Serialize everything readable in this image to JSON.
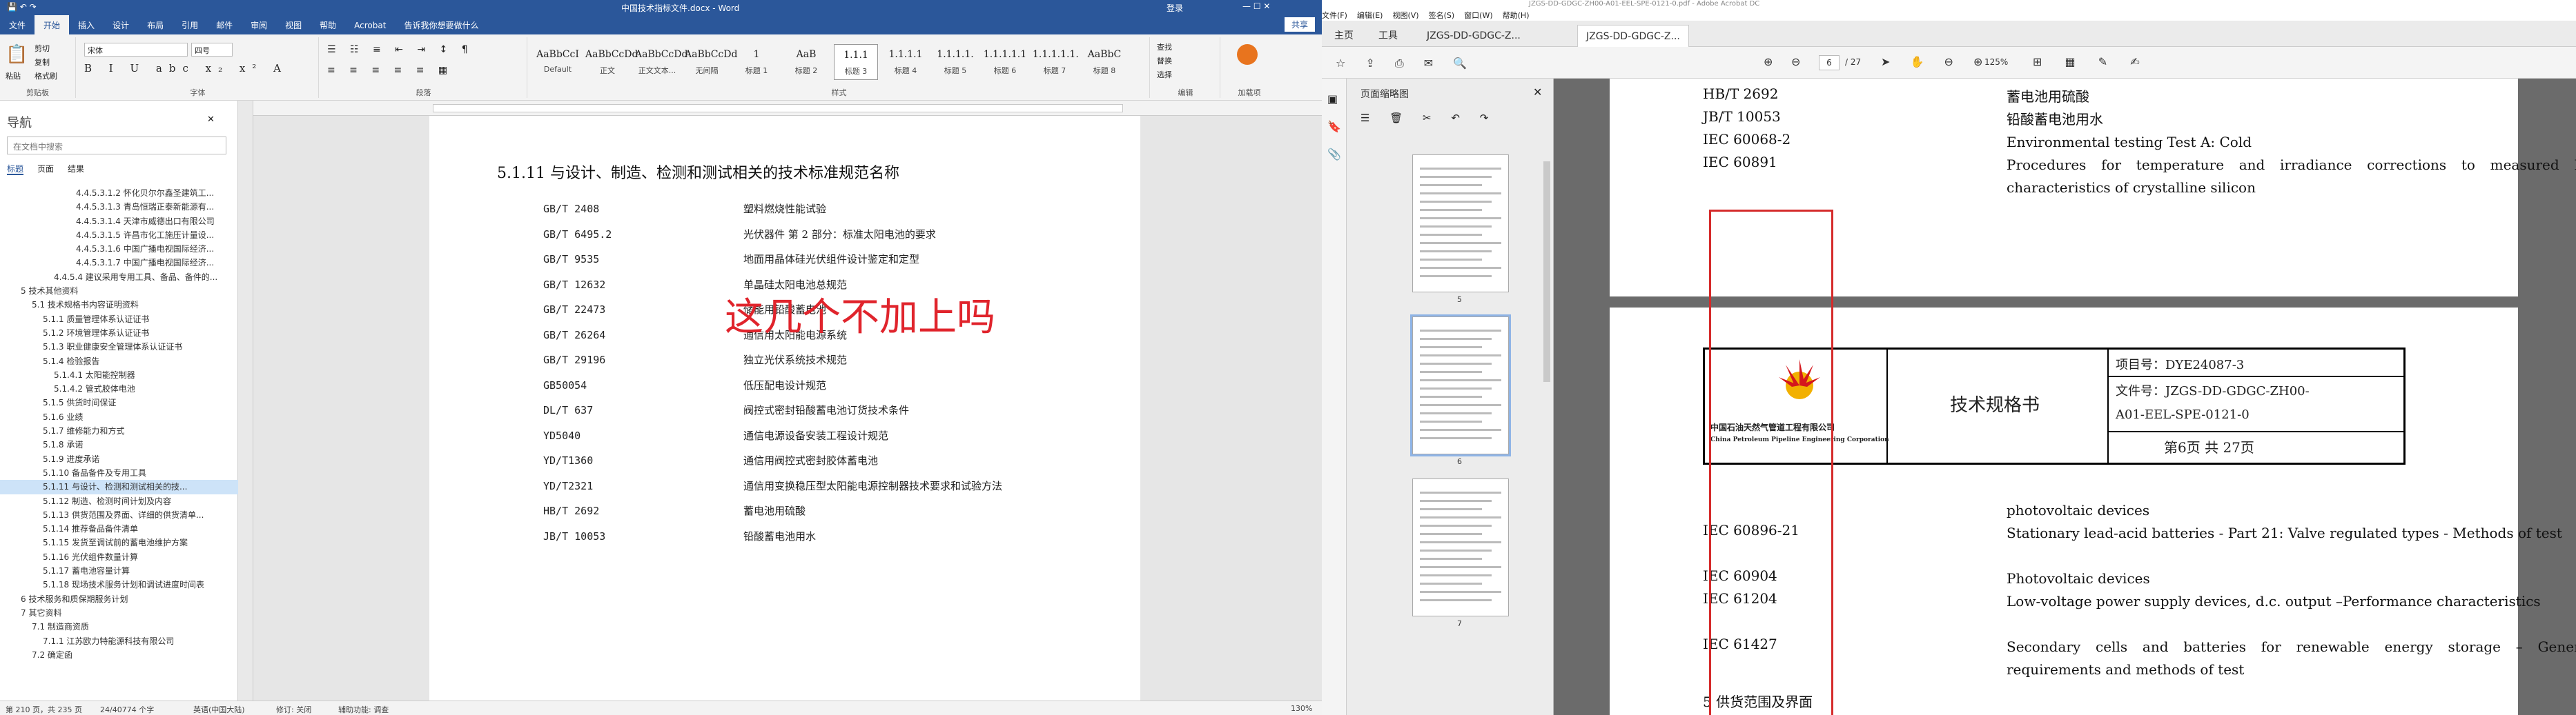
{
  "word": {
    "title": "中国技术指标文件.docx - Word",
    "title_right": "登录",
    "tabs": [
      "文件",
      "开始",
      "插入",
      "设计",
      "布局",
      "引用",
      "邮件",
      "审阅",
      "视图",
      "帮助",
      "Acrobat",
      "告诉我你想要做什么"
    ],
    "share": "共享",
    "ribbon": {
      "clipboard": {
        "paste": "粘贴",
        "cut": "剪切",
        "copy": "复制",
        "format_painter": "格式刷",
        "label": "剪贴板"
      },
      "font": {
        "name": "宋体",
        "size": "四号",
        "label": "字体"
      },
      "paragraph_label": "段落",
      "styles_label": "样式",
      "styles": [
        {
          "preview": "AaBbCcI",
          "name": "Default"
        },
        {
          "preview": "AaBbCcDd",
          "name": "正文"
        },
        {
          "preview": "AaBbCcDd",
          "name": "正文文本..."
        },
        {
          "preview": "AaBbCcDd",
          "name": "无间隔"
        },
        {
          "preview": "1",
          "name": "标题 1"
        },
        {
          "preview": "AaB",
          "name": "标题 2"
        },
        {
          "preview": "1.1.1",
          "name": "标题 3"
        },
        {
          "preview": "1.1.1.1",
          "name": "标题 4"
        },
        {
          "preview": "1.1.1.1.",
          "name": "标题 5"
        },
        {
          "preview": "1.1.1.1.1",
          "name": "标题 6"
        },
        {
          "preview": "1.1.1.1.1.",
          "name": "标题 7"
        },
        {
          "preview": "AaBbC",
          "name": "标题 8"
        }
      ],
      "editing": {
        "find": "查找",
        "replace": "替换",
        "select": "选择",
        "label": "编辑"
      },
      "acrobat": {
        "label": "加载项"
      }
    },
    "nav": {
      "title": "导航",
      "search_placeholder": "在文档中搜索",
      "tabs": [
        "标题",
        "页面",
        "结果"
      ],
      "items": [
        "4.4.5.3.1.2 怀化贝尔尔鑫圣建筑工...",
        "4.4.5.3.1.3 青岛恒瑞正泰新能源有...",
        "4.4.5.3.1.4 天津市威德出口有限公司",
        "4.4.5.3.1.5 许昌市化工施压计量设...",
        "4.4.5.3.1.6 中国广播电视国际经济...",
        "4.4.5.3.1.7 中国广播电视国际经济...",
        "4.4.5.4 建议采用专用工具、备品、备件的...",
        "5 技术其他资料",
        "5.1 技术规格书内容证明资料",
        "5.1.1 质量管理体系认证证书",
        "5.1.2 环境管理体系认证证书",
        "5.1.3 职业健康安全管理体系认证证书",
        "5.1.4 检验报告",
        "5.1.4.1 太阳能控制器",
        "5.1.4.2 管式胶体电池",
        "5.1.5 供货时间保证",
        "5.1.6 业绩",
        "5.1.7 维修能力和方式",
        "5.1.8 承诺",
        "5.1.9 进度承诺",
        "5.1.10 备品备件及专用工具",
        "5.1.11 与设计、检测和测试相关的技...",
        "5.1.12 制造、检测时间计划及内容",
        "5.1.13 供货范围及界面、详细的供货清单...",
        "5.1.14 推荐备品备件清单",
        "5.1.15 发货至调试前的蓄电池维护方案",
        "5.1.16 光伏组件数量计算",
        "5.1.17 蓄电池容量计算",
        "5.1.18 现场技术服务计划和调试进度时间表",
        "6 技术服务和质保期服务计划",
        "7 其它资料",
        "7.1 制造商资质",
        "7.1.1 江苏欧力特能源科技有限公司",
        "7.2 确定函"
      ]
    },
    "doc": {
      "heading": "5.1.11    与设计、制造、检测和测试相关的技术标准规范名称",
      "rows": [
        {
          "code": "GB/T 2408",
          "name": "塑料燃烧性能试验"
        },
        {
          "code": "GB/T 6495.2",
          "name": "光伏器件 第 2 部分：标准太阳电池的要求"
        },
        {
          "code": "GB/T 9535",
          "name": "地面用晶体硅光伏组件设计鉴定和定型"
        },
        {
          "code": "GB/T 12632",
          "name": "单晶硅太阳电池总规范"
        },
        {
          "code": "GB/T 22473",
          "name": "储能用铅酸蓄电池"
        },
        {
          "code": "GB/T 26264",
          "name": "通信用太阳能电源系统"
        },
        {
          "code": "GB/T 29196",
          "name": "独立光伏系统技术规范"
        },
        {
          "code": "GB50054",
          "name": "低压配电设计规范"
        },
        {
          "code": "DL/T 637",
          "name": "阀控式密封铅酸蓄电池订货技术条件"
        },
        {
          "code": "YD5040",
          "name": "通信电源设备安装工程设计规范"
        },
        {
          "code": "YD/T1360",
          "name": "通信用阀控式密封胶体蓄电池"
        },
        {
          "code": "YD/T2321",
          "name": "通信用变换稳压型太阳能电源控制器技术要求和试验方法"
        },
        {
          "code": "HB/T 2692",
          "name": "蓄电池用硫酸"
        },
        {
          "code": "JB/T 10053",
          "name": "铅酸蓄电池用水"
        }
      ],
      "comment": "这几个不加上吗"
    },
    "status": {
      "page": "第 210 页，共 235 页",
      "words": "24/40774 个字",
      "lang": "英语(中国大陆)",
      "track": "修订: 关闭",
      "access": "辅助功能: 调查",
      "zoom": "130%"
    }
  },
  "pdf": {
    "title": "JZGS-DD-GDGC-ZH00-A01-EEL-SPE-0121-0.pdf - Adobe Acrobat DC",
    "menu": [
      "文件(F)",
      "编辑(E)",
      "视图(V)",
      "签名(S)",
      "窗口(W)",
      "帮助(H)"
    ],
    "tabs": [
      "主页",
      "工具",
      "JZGS-DD-GDGC-Z...",
      "JZGS-DD-GDGC-Z..."
    ],
    "toolbar": {
      "page_current": "6",
      "page_total": "/ 27",
      "zoom": "125%"
    },
    "thumbs": {
      "title": "页面缩略图",
      "pages": [
        "5",
        "6",
        "7"
      ]
    },
    "page1_rows": [
      {
        "code": "HB/T 2692",
        "desc": "蓄电池用硫酸"
      },
      {
        "code": "JB/T 10053",
        "desc": "铅酸蓄电池用水"
      },
      {
        "code": "IEC 60068-2",
        "desc": "Environmental testing Test A: Cold"
      },
      {
        "code": "IEC 60891",
        "desc": "Procedures for temperature and irradiance corrections to measured I-V characteristics of crystalline silicon"
      }
    ],
    "header": {
      "company_cn": "中国石油天然气管道工程有限公司",
      "company_en": "China Petroleum Pipeline Engineering Corporation",
      "doc_type": "技术规格书",
      "project": "项目号：DYE24087-3",
      "file_no": "文件号：JZGS-DD-GDGC-ZH00-",
      "file_no2": "A01-EEL-SPE-0121-0",
      "page": "第6页    共 27页"
    },
    "page2_rows": [
      {
        "code": "",
        "desc": "photovoltaic devices"
      },
      {
        "code": "IEC 60896-21",
        "desc": "Stationary lead-acid batteries - Part 21: Valve regulated types - Methods of test"
      },
      {
        "code": "IEC 60904",
        "desc": "Photovoltaic devices"
      },
      {
        "code": "IEC 61204",
        "desc": "Low-voltage power supply devices, d.c. output –Performance characteristics"
      },
      {
        "code": "IEC 61427",
        "desc": "Secondary cells and batteries for renewable energy storage – General requirements and methods of test"
      }
    ],
    "section5": "5    供货范围及界面"
  }
}
